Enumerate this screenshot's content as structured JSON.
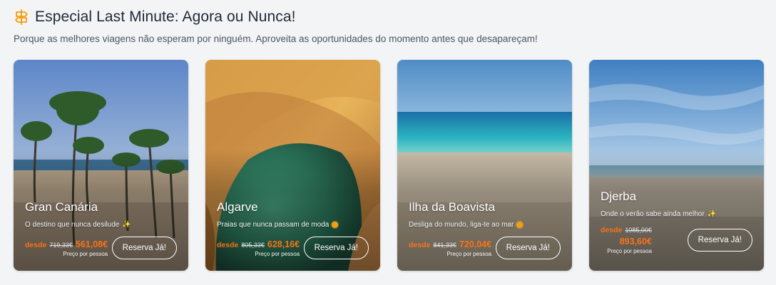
{
  "section": {
    "title": "Especial Last Minute: Agora ou Nunca!",
    "subtitle": "Porque as melhores viagens não esperam por ninguém. Aproveita as oportunidades do momento antes que desapareçam!",
    "icon": "signpost-icon"
  },
  "cards": [
    {
      "title": "Gran Canária",
      "desc": "O destino que nunca desilude",
      "emoji": "sparkles-icon",
      "desde": "desde",
      "old_price": "719,33€",
      "new_price": "561,08€",
      "per_person": "Preço por pessoa",
      "button": "Reserva Já!"
    },
    {
      "title": "Algarve",
      "desc": "Praias que nunca passam de moda",
      "emoji": "sun-icon",
      "desde": "desde",
      "old_price": "805,33€",
      "new_price": "628,16€",
      "per_person": "Preço por pessoa",
      "button": "Reserva Já!"
    },
    {
      "title": "Ilha da Boavista",
      "desc": "Desliga do mundo, liga-te ao mar",
      "emoji": "sun-icon",
      "desde": "desde",
      "old_price": "841,33€",
      "new_price": "720,04€",
      "per_person": "Preço por pessoa",
      "button": "Reserva Já!"
    },
    {
      "title": "Djerba",
      "desc": "Onde o verão sabe ainda melhor",
      "emoji": "sparkles-icon",
      "desde": "desde",
      "old_price": "1085,00€",
      "new_price": "893,60€",
      "per_person": "Preço por pessoa",
      "button": "Reserva Já!"
    }
  ],
  "colors": {
    "accent": "#f97316",
    "icon": "#f59e0b",
    "background": "#f3f4f6"
  }
}
